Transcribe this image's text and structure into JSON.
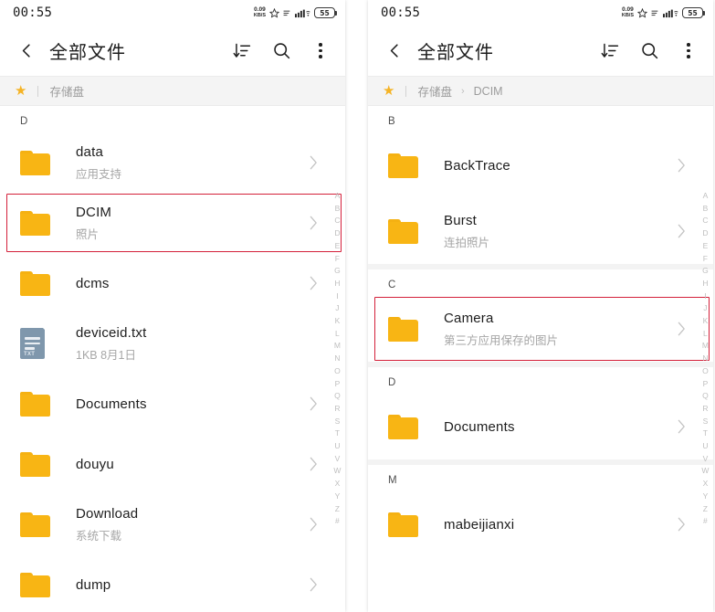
{
  "meta": {
    "accent_folder": "#f8b514",
    "highlight_color": "#d4203a",
    "star_color": "#f5b324",
    "txt_icon_color": "#7f97ac"
  },
  "statusbar": {
    "time": "00:55",
    "net_speed_value": "0.09",
    "net_speed_unit": "KB/S",
    "battery_level": "55",
    "icons": [
      "star-outline-icon",
      "signal-bars-icon",
      "wifi-icon",
      "battery-icon"
    ]
  },
  "appbar": {
    "back_icon": "chevron-left-icon",
    "title": "全部文件",
    "sort_icon": "sort-descending-icon",
    "search_icon": "search-icon",
    "overflow_icon": "more-vertical-icon"
  },
  "alphabet_index": [
    "A",
    "B",
    "C",
    "D",
    "E",
    "F",
    "G",
    "H",
    "I",
    "J",
    "K",
    "L",
    "M",
    "N",
    "O",
    "P",
    "Q",
    "R",
    "S",
    "T",
    "U",
    "V",
    "W",
    "X",
    "Y",
    "Z",
    "#"
  ],
  "left_panel": {
    "breadcrumb": {
      "star_icon": "star-filled-icon",
      "items": [
        "存储盘"
      ],
      "separator": "›"
    },
    "sections": [
      {
        "letter": "D",
        "rows": [
          {
            "icon": "folder-icon",
            "title": "data",
            "subtitle": "应用支持",
            "chevron": "›",
            "highlighted": false
          },
          {
            "icon": "folder-icon",
            "title": "DCIM",
            "subtitle": "照片",
            "chevron": "›",
            "highlighted": true
          },
          {
            "icon": "folder-icon",
            "title": "dcms",
            "subtitle": "",
            "chevron": "›",
            "highlighted": false
          },
          {
            "icon": "txt-file-icon",
            "title": "deviceid.txt",
            "subtitle": "1KB  8月1日",
            "chevron": "",
            "highlighted": false
          },
          {
            "icon": "folder-icon",
            "title": "Documents",
            "subtitle": "",
            "chevron": "›",
            "highlighted": false
          },
          {
            "icon": "folder-icon",
            "title": "douyu",
            "subtitle": "",
            "chevron": "›",
            "highlighted": false
          },
          {
            "icon": "folder-icon",
            "title": "Download",
            "subtitle": "系统下载",
            "chevron": "›",
            "highlighted": false
          },
          {
            "icon": "folder-icon",
            "title": "dump",
            "subtitle": "",
            "chevron": "›",
            "highlighted": false
          }
        ]
      }
    ]
  },
  "right_panel": {
    "breadcrumb": {
      "star_icon": "star-filled-icon",
      "items": [
        "存储盘",
        "DCIM"
      ],
      "separator": "›"
    },
    "sections": [
      {
        "letter": "B",
        "rows": [
          {
            "icon": "folder-icon",
            "title": "BackTrace",
            "subtitle": "",
            "chevron": "›",
            "highlighted": false
          },
          {
            "icon": "folder-icon",
            "title": "Burst",
            "subtitle": "连拍照片",
            "chevron": "›",
            "highlighted": false
          }
        ]
      },
      {
        "letter": "C",
        "rows": [
          {
            "icon": "folder-icon",
            "title": "Camera",
            "subtitle": "第三方应用保存的图片",
            "chevron": "›",
            "highlighted": true
          }
        ]
      },
      {
        "letter": "D",
        "rows": [
          {
            "icon": "folder-icon",
            "title": "Documents",
            "subtitle": "",
            "chevron": "›",
            "highlighted": false
          }
        ]
      },
      {
        "letter": "M",
        "rows": [
          {
            "icon": "folder-icon",
            "title": "mabeijianxi",
            "subtitle": "",
            "chevron": "›",
            "highlighted": false
          }
        ]
      }
    ]
  }
}
